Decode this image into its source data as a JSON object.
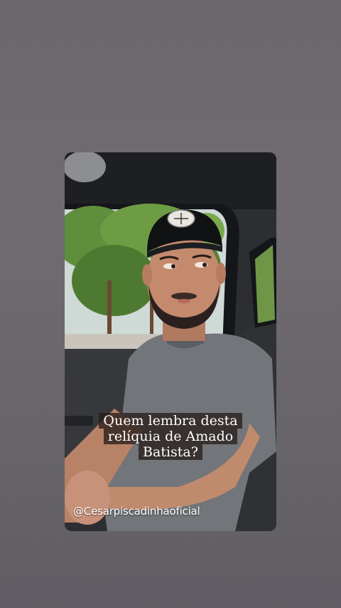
{
  "story": {
    "caption_lines": [
      "Quem lembra desta",
      "relíquia de Amado",
      "Batista?"
    ],
    "handle": "@Cesarpiscadinhaoficial"
  },
  "colors": {
    "background": "#6c686d",
    "caption_bg": "#281e1c",
    "caption_text": "#ffffff"
  },
  "icons": [
    "cap-logo-icon"
  ]
}
